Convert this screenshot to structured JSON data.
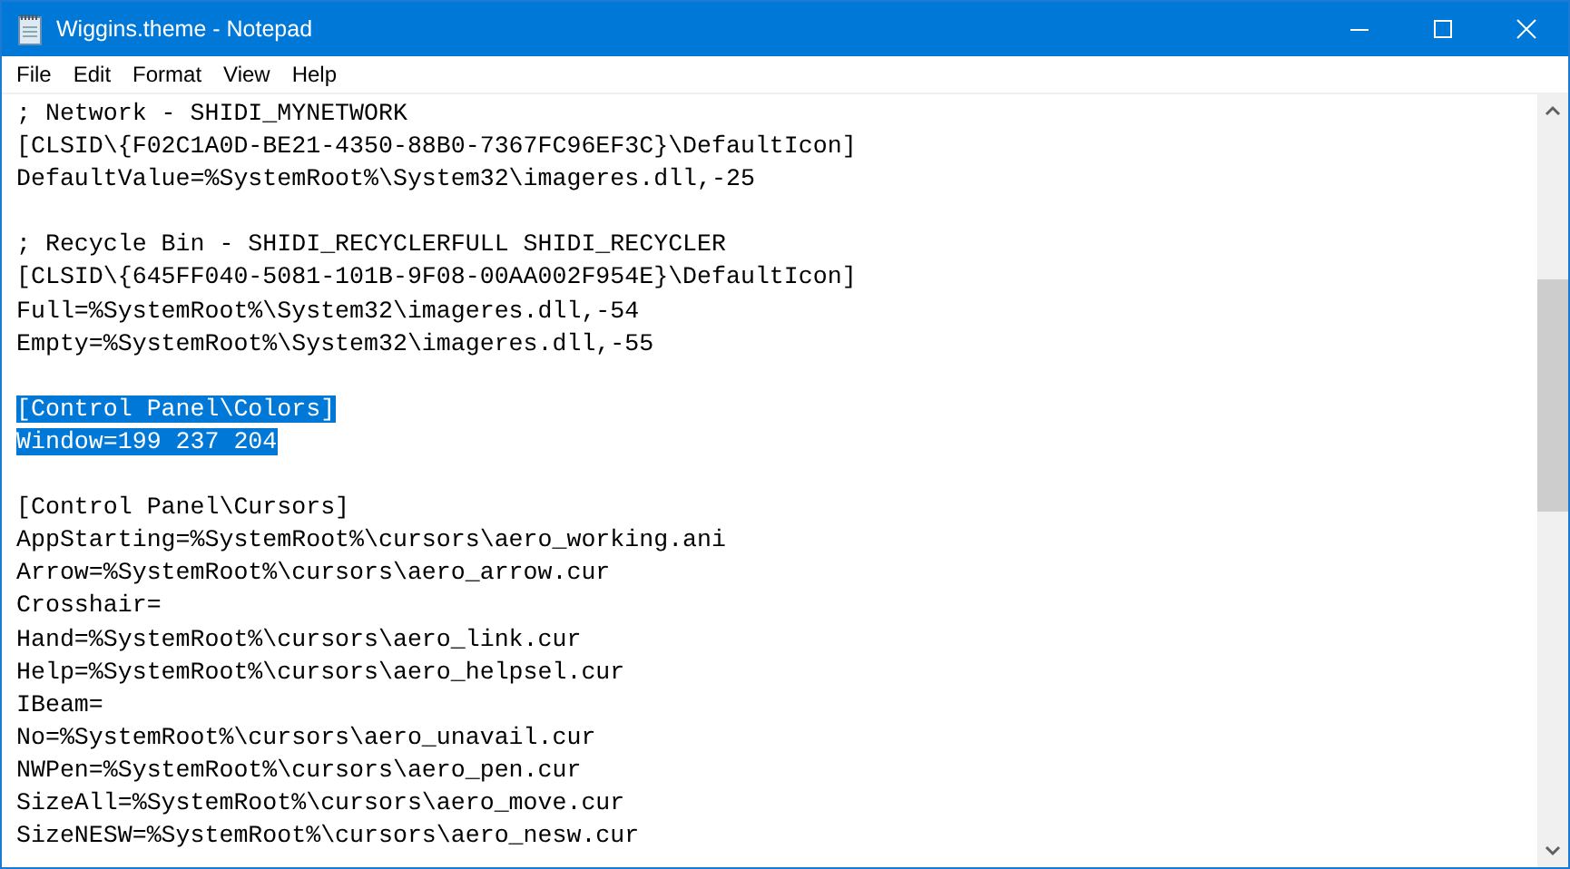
{
  "window": {
    "title": "Wiggins.theme - Notepad"
  },
  "menu": [
    "File",
    "Edit",
    "Format",
    "View",
    "Help"
  ],
  "lines": [
    {
      "kind": "text",
      "text": "; Network - SHIDI_MYNETWORK",
      "selected": false
    },
    {
      "kind": "text",
      "text": "[CLSID\\{F02C1A0D-BE21-4350-88B0-7367FC96EF3C}\\DefaultIcon]",
      "selected": false
    },
    {
      "kind": "text",
      "text": "DefaultValue=%SystemRoot%\\System32\\imageres.dll,-25",
      "selected": false
    },
    {
      "kind": "blank"
    },
    {
      "kind": "text",
      "text": "; Recycle Bin - SHIDI_RECYCLERFULL SHIDI_RECYCLER",
      "selected": false
    },
    {
      "kind": "text",
      "text": "[CLSID\\{645FF040-5081-101B-9F08-00AA002F954E}\\DefaultIcon]",
      "selected": false
    },
    {
      "kind": "text",
      "text": "Full=%SystemRoot%\\System32\\imageres.dll,-54",
      "selected": false
    },
    {
      "kind": "text",
      "text": "Empty=%SystemRoot%\\System32\\imageres.dll,-55",
      "selected": false
    },
    {
      "kind": "blank"
    },
    {
      "kind": "text",
      "text": "[Control Panel\\Colors]",
      "selected": true
    },
    {
      "kind": "text",
      "text": "Window=199 237 204",
      "selected": true
    },
    {
      "kind": "blank"
    },
    {
      "kind": "text",
      "text": "[Control Panel\\Cursors]",
      "selected": false
    },
    {
      "kind": "text",
      "text": "AppStarting=%SystemRoot%\\cursors\\aero_working.ani",
      "selected": false
    },
    {
      "kind": "text",
      "text": "Arrow=%SystemRoot%\\cursors\\aero_arrow.cur",
      "selected": false
    },
    {
      "kind": "text",
      "text": "Crosshair=",
      "selected": false
    },
    {
      "kind": "text",
      "text": "Hand=%SystemRoot%\\cursors\\aero_link.cur",
      "selected": false
    },
    {
      "kind": "text",
      "text": "Help=%SystemRoot%\\cursors\\aero_helpsel.cur",
      "selected": false
    },
    {
      "kind": "text",
      "text": "IBeam=",
      "selected": false
    },
    {
      "kind": "text",
      "text": "No=%SystemRoot%\\cursors\\aero_unavail.cur",
      "selected": false
    },
    {
      "kind": "text",
      "text": "NWPen=%SystemRoot%\\cursors\\aero_pen.cur",
      "selected": false
    },
    {
      "kind": "text",
      "text": "SizeAll=%SystemRoot%\\cursors\\aero_move.cur",
      "selected": false
    },
    {
      "kind": "text",
      "text": "SizeNESW=%SystemRoot%\\cursors\\aero_nesw.cur",
      "selected": false
    }
  ]
}
